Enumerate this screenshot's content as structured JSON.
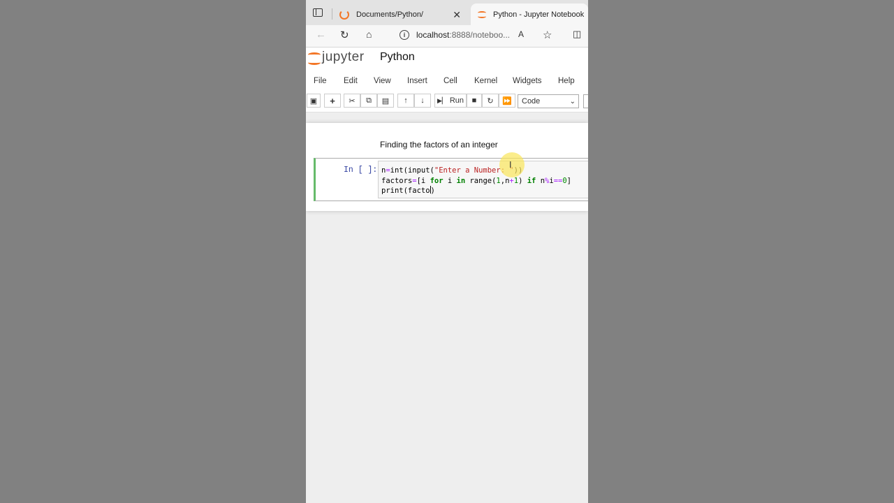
{
  "browser": {
    "tabs": [
      {
        "title": "Documents/Python/",
        "active": false
      },
      {
        "title": "Python - Jupyter Notebook",
        "active": true
      }
    ],
    "url_host": "localhost",
    "url_rest": ":8888/noteboo..."
  },
  "jupyter": {
    "logo_text": "jupyter",
    "notebook_title": "Python",
    "menu": [
      "File",
      "Edit",
      "View",
      "Insert",
      "Cell",
      "Kernel",
      "Widgets",
      "Help"
    ],
    "toolbar": {
      "run_label": "Run",
      "cell_type": "Code"
    }
  },
  "notebook": {
    "markdown_text": "Finding the factors of an integer",
    "cell_prompt": "In [ ]:",
    "code_lines": [
      "n=int(input(\"Enter a Number: \"))",
      "factors=[i for i in range(1,n+1) if n%i==0]",
      "print(facto)"
    ]
  },
  "colors": {
    "accent": "#f37626",
    "cell_border_active": "#66bb6a",
    "prompt": "#303f9f"
  }
}
